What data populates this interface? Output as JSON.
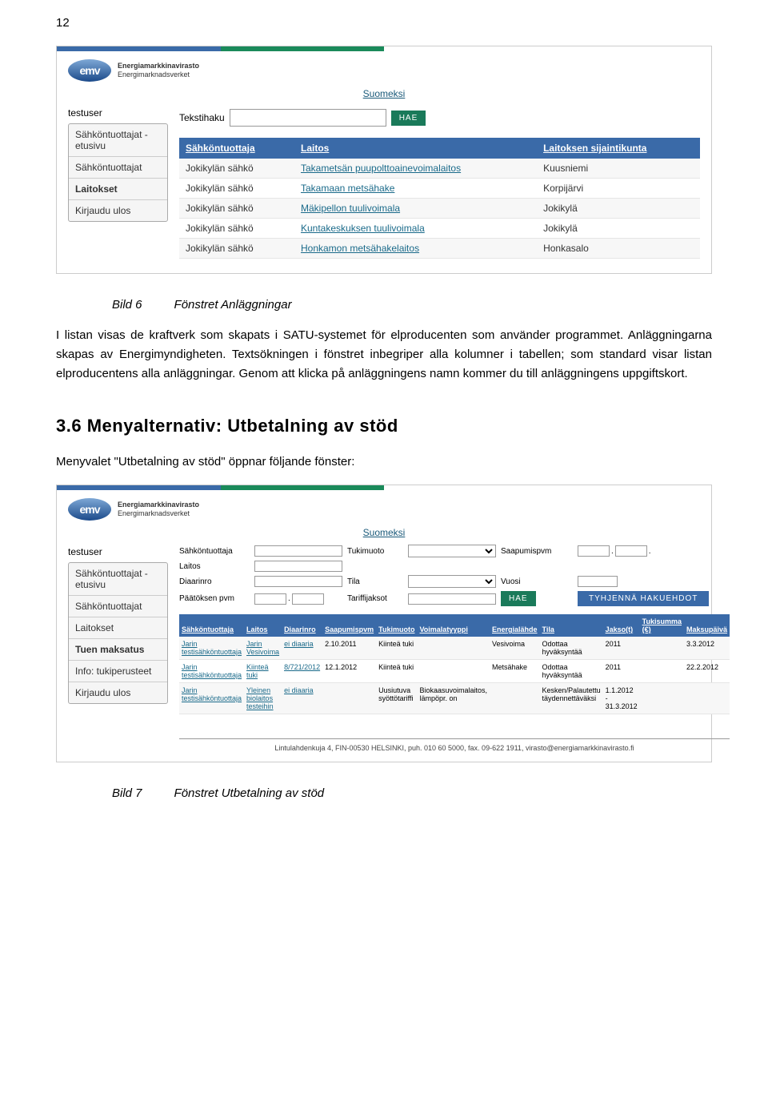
{
  "page_number": "12",
  "caption1": {
    "id": "Bild 6",
    "title": "Fönstret Anläggningar"
  },
  "para1": "I listan visas de kraftverk som skapats i SATU-systemet för elproducenten som använder programmet. Anläggningarna skapas av Energimyndigheten. Textsökningen i fönstret inbegriper alla kolumner i tabellen; som standard visar listan elproducentens alla anläggningar. Genom att klicka på anläggningens namn kommer du till anläggningens uppgiftskort.",
  "section": "3.6 Menyalternativ: Utbetalning av stöd",
  "para2": "Menyvalet \"Utbetalning av stöd\" öppnar följande fönster:",
  "caption2": {
    "id": "Bild 7",
    "title": "Fönstret Utbetalning av stöd"
  },
  "logo_sub": {
    "l1": "Energiamarkkinavirasto",
    "l2": "Energimarknadsverket"
  },
  "lang_link": "Suomeksi",
  "user": "testuser",
  "screenshot1": {
    "sidebar": [
      {
        "label": "Sähköntuottajat - etusivu",
        "selected": false
      },
      {
        "label": "Sähköntuottajat",
        "selected": false
      },
      {
        "label": "Laitokset",
        "selected": true
      },
      {
        "label": "Kirjaudu ulos",
        "selected": false
      }
    ],
    "search_label": "Tekstihaku",
    "hae": "HAE",
    "columns": [
      "Sähköntuottaja",
      "Laitos",
      "Laitoksen sijaintikunta"
    ],
    "rows": [
      [
        "Jokikylän sähkö",
        "Takametsän puupolttoainevoimalaitos",
        "Kuusniemi"
      ],
      [
        "Jokikylän sähkö",
        "Takamaan metsähake",
        "Korpijärvi"
      ],
      [
        "Jokikylän sähkö",
        "Mäkipellon tuulivoimala",
        "Jokikylä"
      ],
      [
        "Jokikylän sähkö",
        "Kuntakeskuksen tuulivoimala",
        "Jokikylä"
      ],
      [
        "Jokikylän sähkö",
        "Honkamon metsähakelaitos",
        "Honkasalo"
      ]
    ]
  },
  "screenshot2": {
    "sidebar": [
      {
        "label": "Sähköntuottajat - etusivu",
        "selected": false
      },
      {
        "label": "Sähköntuottajat",
        "selected": false
      },
      {
        "label": "Laitokset",
        "selected": false
      },
      {
        "label": "Tuen maksatus",
        "selected": true
      },
      {
        "label": "Info: tukiperusteet",
        "selected": false
      },
      {
        "label": "Kirjaudu ulos",
        "selected": false
      }
    ],
    "filters": {
      "Sähköntuottaja": "Sähköntuottaja",
      "Laitos": "Laitos",
      "Diaarinro": "Diaarinro",
      "Päätöksen_pvm": "Päätöksen pvm",
      "Tukimuoto": "Tukimuoto",
      "Tila": "Tila",
      "Tariffijaksot": "Tariffijaksot",
      "Saapumispvm": "Saapumispvm",
      "Vuosi": "Vuosi"
    },
    "hae": "HAE",
    "clear": "TYHJENNÄ HAKUEHDOT",
    "columns": [
      "Sähköntuottaja",
      "Laitos",
      "Diaarinro",
      "Saapumispvm",
      "Tukimuoto",
      "Voimalatyyppi",
      "Energialähde",
      "Tila",
      "Jakso(t)",
      "Tukisumma (€)",
      "Maksupäivä"
    ],
    "rows": [
      {
        "cells": [
          "Jarin testisähköntuottaja",
          "Jarin Vesivoima",
          "ei diaaria",
          "2.10.2011",
          "Kiinteä tuki",
          "",
          "Vesivoima",
          "Odottaa hyväksyntää",
          "2011",
          "",
          "3.3.2012"
        ]
      },
      {
        "cells": [
          "Jarin testisähköntuottaja",
          "Kiinteä tuki",
          "8/721/2012",
          "12.1.2012",
          "Kiinteä tuki",
          "",
          "Metsähake",
          "Odottaa hyväksyntää",
          "2011",
          "",
          "22.2.2012"
        ]
      },
      {
        "cells": [
          "Jarin testisähköntuottaja",
          "Yleinen biolaitos testeihin",
          "ei diaaria",
          "",
          "Uusiutuva syöttötariffi",
          "Biokaasuvoimalaitos, lämpöpr. on",
          "",
          "Kesken/Palautettu täydennettäväksi",
          "1.1.2012 - 31.3.2012",
          "",
          ""
        ]
      }
    ],
    "footer": "Lintulahdenkuja 4, FIN-00530 HELSINKI, puh. 010 60 5000, fax. 09-622 1911, virasto@energiamarkkinavirasto.fi"
  }
}
